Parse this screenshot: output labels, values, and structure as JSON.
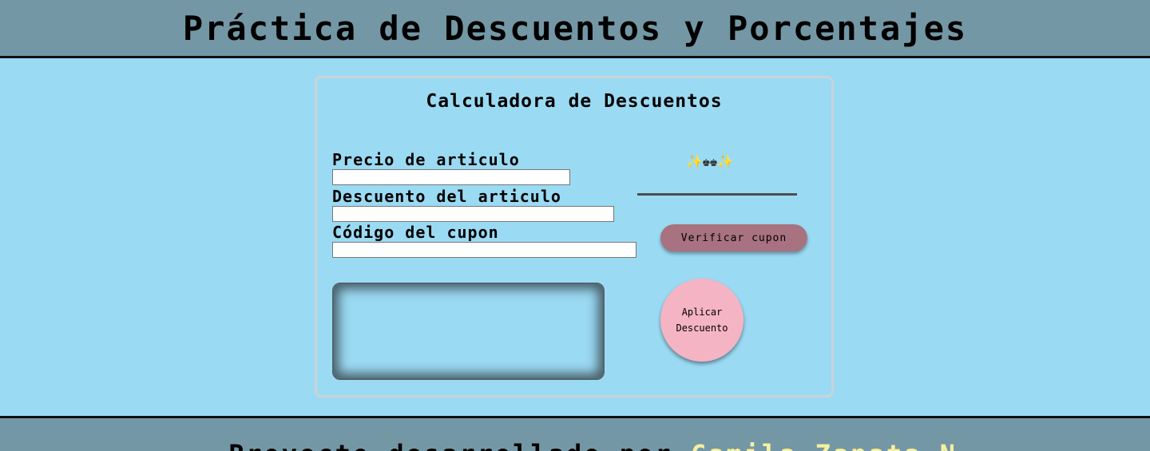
{
  "header": {
    "title": "Práctica de Descuentos y Porcentajes"
  },
  "calculator": {
    "title": "Calculadora de Descuentos",
    "price_label": "Precio de articulo",
    "price_value": "",
    "discount_label": "Descuento del articulo",
    "discount_value": "",
    "coupon_label": "Código del cupon",
    "coupon_value": "",
    "decoration": "✨♚♚✨",
    "verify_button": "Verificar cupon",
    "apply_button": "Aplicar Descuento",
    "result_text": ""
  },
  "footer": {
    "text": "Proyecto desarrollado por",
    "name": "Camila Zapata N."
  },
  "colors": {
    "background": "#9bdaf3",
    "header_bg": "#7497a5",
    "verify_button": "#a87280",
    "apply_button": "#f5b4c4",
    "footer_name": "#f4f0a0"
  }
}
